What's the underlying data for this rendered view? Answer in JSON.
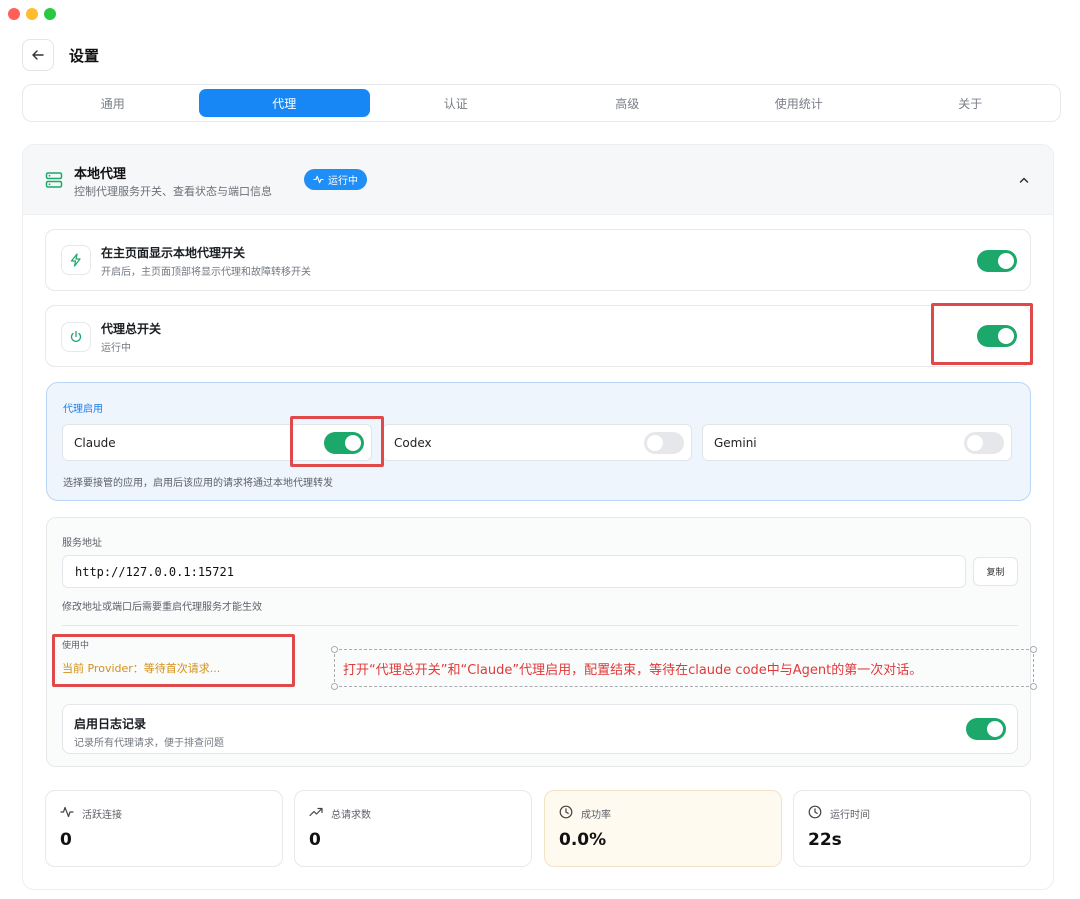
{
  "page": {
    "title": "设置"
  },
  "tabs": [
    {
      "label": "通用"
    },
    {
      "label": "代理"
    },
    {
      "label": "认证"
    },
    {
      "label": "高级"
    },
    {
      "label": "使用统计"
    },
    {
      "label": "关于"
    }
  ],
  "active_tab": "代理",
  "section": {
    "title": "本地代理",
    "subtitle": "控制代理服务开关、查看状态与端口信息",
    "badge": "运行中"
  },
  "show_toggle_card": {
    "title": "在主页面显示本地代理开关",
    "subtitle": "开启后，主页面顶部将显示代理和故障转移开关",
    "enabled": true
  },
  "master_switch": {
    "title": "代理总开关",
    "subtitle": "运行中",
    "enabled": true
  },
  "apps": {
    "title": "代理启用",
    "items": [
      {
        "name": "Claude",
        "enabled": true
      },
      {
        "name": "Codex",
        "enabled": false
      },
      {
        "name": "Gemini",
        "enabled": false
      }
    ],
    "hint": "选择要接管的应用，启用后该应用的请求将通过本地代理转发"
  },
  "service": {
    "label": "服务地址",
    "address": "http://127.0.0.1:15721",
    "copy_label": "复制",
    "hint": "修改地址或端口后需要重启代理服务才能生效",
    "in_use_label": "使用中",
    "provider_text": "当前 Provider：等待首次请求..."
  },
  "annotation": "打开“代理总开关”和“Claude”代理启用，配置结束，等待在claude code中与Agent的第一次对话。",
  "logging": {
    "title": "启用日志记录",
    "subtitle": "记录所有代理请求，便于排查问题",
    "enabled": true
  },
  "stats": [
    {
      "label": "活跃连接",
      "value": "0",
      "icon": "activity-icon"
    },
    {
      "label": "总请求数",
      "value": "0",
      "icon": "trending-up-icon"
    },
    {
      "label": "成功率",
      "value": "0.0%",
      "icon": "clock-icon"
    },
    {
      "label": "运行时间",
      "value": "22s",
      "icon": "clock-icon"
    }
  ],
  "colors": {
    "accent": "#1787f5",
    "toggle_on": "#1da86b",
    "highlight": "#e0494a",
    "provider_waiting": "#d49019"
  }
}
